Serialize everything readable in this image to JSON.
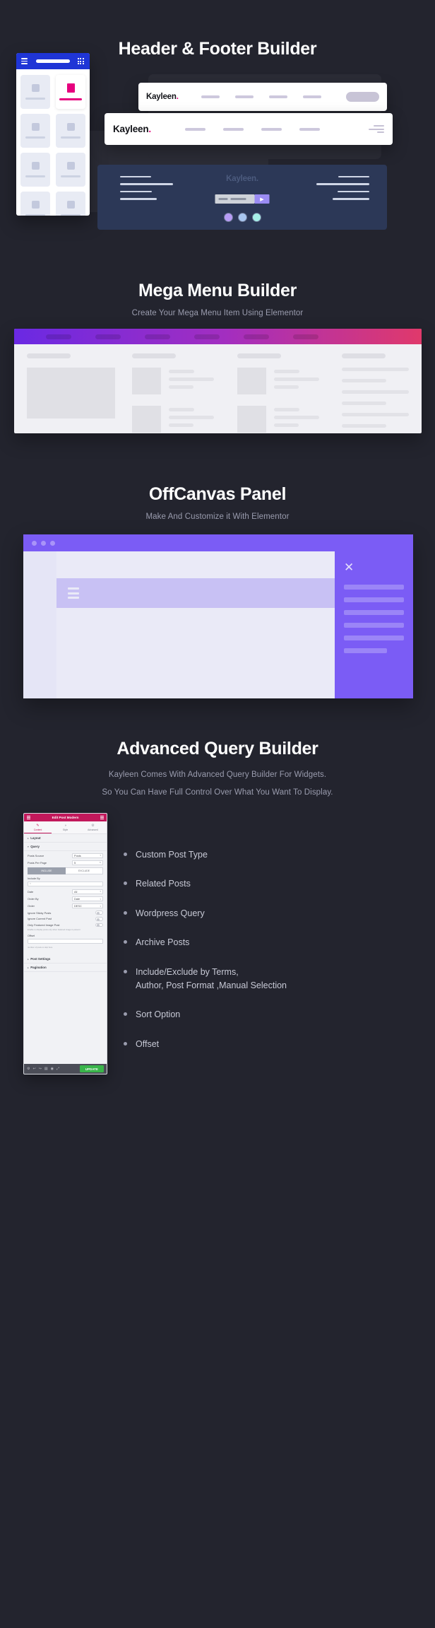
{
  "sections": {
    "header_footer": {
      "title": "Header & Footer Builder",
      "brand": "Kayleen",
      "brand_dot": ".",
      "footer_brand": "Kayleen."
    },
    "mega_menu": {
      "title": "Mega Menu Builder",
      "subtitle": "Create Your Mega Menu Item Using Elementor"
    },
    "offcanvas": {
      "title": "OffCanvas Panel",
      "subtitle": "Make And Customize it With Elementor",
      "close_icon": "✕"
    },
    "query_builder": {
      "title": "Advanced Query Builder",
      "line1": "Kayleen Comes With Advanced Query Builder For Widgets.",
      "line2": "So You Can Have Full Control Over What You Want To Display.",
      "features": [
        {
          "label": "Custom Post Type",
          "label2": ""
        },
        {
          "label": "Related Posts",
          "label2": ""
        },
        {
          "label": "Wordpress Query",
          "label2": ""
        },
        {
          "label": "Archive Posts",
          "label2": ""
        },
        {
          "label": "Include/Exclude by Terms,",
          "label2": "Author, Post Format ,Manual Selection"
        },
        {
          "label": "Sort Option",
          "label2": ""
        },
        {
          "label": "Offset",
          "label2": ""
        }
      ],
      "panel": {
        "header_title": "Edit Post Modern",
        "tabs": [
          {
            "label": "Content",
            "icon": "✎",
            "active": true
          },
          {
            "label": "Style",
            "icon": "◑",
            "active": false
          },
          {
            "label": "Advanced",
            "icon": "⚙",
            "active": false
          }
        ],
        "section_layout": "Layout",
        "section_query": "Query",
        "section_post_settings": "Post Settings",
        "section_pagination": "Pagination",
        "rows": [
          {
            "label": "Posts Source",
            "value": "Posts"
          },
          {
            "label": "Posts Per Page",
            "value": "5"
          }
        ],
        "segment": {
          "include": "INCLUDE",
          "exclude": "EXCLUDE"
        },
        "include_by_label": "Include By",
        "include_by_value": "×",
        "selects": [
          {
            "label": "Date",
            "value": "All"
          },
          {
            "label": "Order By",
            "value": "Date"
          },
          {
            "label": "Order",
            "value": "DESC"
          }
        ],
        "toggles": [
          {
            "label": "Ignore Sticky Posts"
          },
          {
            "label": "Ignore Current Post"
          },
          {
            "label": "Only Featured Image Post"
          }
        ],
        "featured_note": "Enable to display posts only when featured image is present",
        "offset_label": "Offset",
        "offset_note": "number of posts to skip here",
        "footer_update": "UPDATE",
        "footer_tools": [
          "⚙",
          "↩",
          "↪",
          "▤",
          "◉",
          "⤢"
        ]
      }
    }
  },
  "colors": {
    "page_bg": "#23242e",
    "accent_pink": "#e6007e",
    "accent_purple": "#7b5cf5",
    "nav_blue": "#1f35d6",
    "footer_navy": "#2c3857",
    "elementor_pink": "#c2185b",
    "update_green": "#39b54a"
  }
}
